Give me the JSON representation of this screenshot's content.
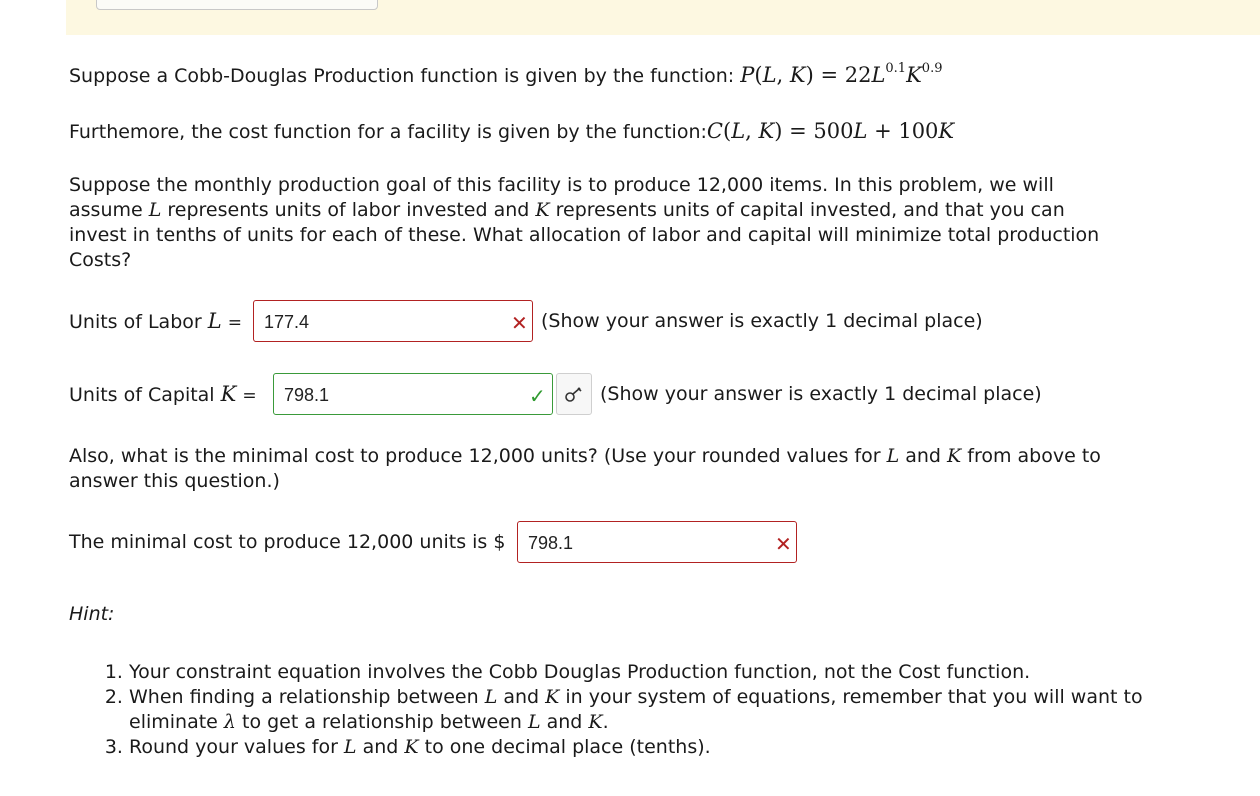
{
  "intro": {
    "production_text": "Suppose a Cobb-Douglas Production function is given by the function: ",
    "production_formula": "P(L, K) = 22L^0.1 K^0.9",
    "cost_text": "Furthemore, the cost function for a facility is given by the function:",
    "cost_formula": "C(L, K) = 500L + 100K",
    "problem_part1": "Suppose the monthly production goal of this facility is to produce 12,000 items. In this problem, we will assume ",
    "problem_part2": " represents units of labor invested and ",
    "problem_part3": " represents units of capital invested, and that you can invest in tenths of units for each of these. What allocation of labor and capital will minimize total production Costs?"
  },
  "labor": {
    "label": "Units of Labor",
    "var": "L",
    "equals": "=",
    "value": "177.4",
    "status": "incorrect",
    "note": "(Show your answer is exactly 1 decimal place)"
  },
  "capital": {
    "label": "Units of Capital",
    "var": "K",
    "equals": "=",
    "value": "798.1",
    "status": "correct",
    "note": "(Show your answer is exactly 1 decimal place)"
  },
  "cost_question": {
    "part1": "Also, what is the minimal cost to produce 12,000 units? (Use your rounded values for ",
    "part2": " and ",
    "part3": " from above to answer this question.)"
  },
  "cost_answer": {
    "label": "The minimal cost to produce 12,000 units is $",
    "value": "798.1",
    "status": "incorrect"
  },
  "hint": {
    "label": "Hint:",
    "item1": "Your constraint equation involves the Cobb Douglas Production function, not the Cost function.",
    "item2_a": "When finding a relationship between ",
    "item2_b": " and ",
    "item2_c": " in your system of equations, remember that you will want to eliminate ",
    "item2_d": " to get a relationship between ",
    "item2_e": " and ",
    "item2_f": ".",
    "item3_a": "Round your values for ",
    "item3_b": " and ",
    "item3_c": " to one decimal place (tenths)."
  },
  "symbols": {
    "L": "L",
    "K": "K",
    "lambda": "λ"
  },
  "colors": {
    "incorrect": "#b22222",
    "correct": "#2f9a2f",
    "banner": "#fdf8e1"
  },
  "icons": {
    "incorrect": "x-mark-icon",
    "correct": "check-icon",
    "key": "key-icon"
  }
}
